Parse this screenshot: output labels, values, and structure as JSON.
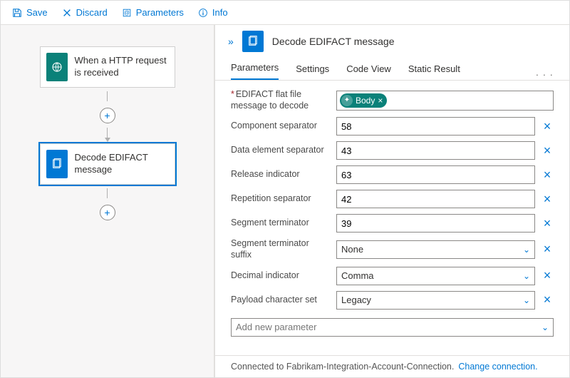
{
  "toolbar": {
    "save": "Save",
    "discard": "Discard",
    "parameters": "Parameters",
    "info": "Info"
  },
  "canvas": {
    "trigger_title": "When a HTTP request is received",
    "action_title": "Decode EDIFACT message"
  },
  "panel": {
    "title": "Decode EDIFACT message",
    "tabs": {
      "parameters": "Parameters",
      "settings": "Settings",
      "code_view": "Code View",
      "static_result": "Static Result"
    },
    "fields": {
      "flat_file_label": "EDIFACT flat file message to decode",
      "body_pill": "Body",
      "component_separator_label": "Component separator",
      "component_separator_value": "58",
      "data_element_separator_label": "Data element separator",
      "data_element_separator_value": "43",
      "release_indicator_label": "Release indicator",
      "release_indicator_value": "63",
      "repetition_separator_label": "Repetition separator",
      "repetition_separator_value": "42",
      "segment_terminator_label": "Segment terminator",
      "segment_terminator_value": "39",
      "segment_terminator_suffix_label": "Segment terminator suffix",
      "segment_terminator_suffix_value": "None",
      "decimal_indicator_label": "Decimal indicator",
      "decimal_indicator_value": "Comma",
      "payload_charset_label": "Payload character set",
      "payload_charset_value": "Legacy",
      "add_new_parameter": "Add new parameter"
    },
    "footer": {
      "connected_text": "Connected to Fabrikam-Integration-Account-Connection.",
      "change_link": "Change connection."
    }
  }
}
